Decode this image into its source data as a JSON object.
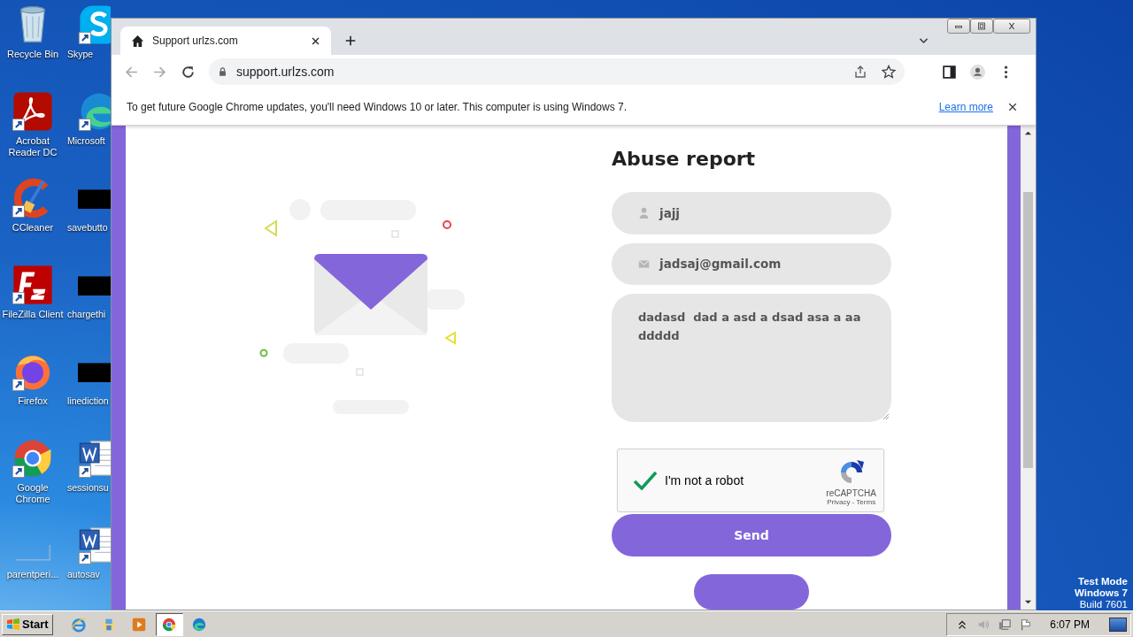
{
  "desktop": {
    "icons": [
      {
        "kind": "recycle",
        "label": "Recycle Bin",
        "shortcut": false
      },
      {
        "kind": "acrobat",
        "label": "Acrobat Reader DC",
        "shortcut": true
      },
      {
        "kind": "ccleaner",
        "label": "CCleaner",
        "shortcut": true
      },
      {
        "kind": "filezilla",
        "label": "FileZilla Client",
        "shortcut": true
      },
      {
        "kind": "firefox",
        "label": "Firefox",
        "shortcut": true
      },
      {
        "kind": "chrome",
        "label": "Google Chrome",
        "shortcut": true
      },
      {
        "kind": "blank",
        "label": "parentperi...",
        "shortcut": false
      },
      {
        "kind": "skype",
        "label": "Skype",
        "shortcut": true
      },
      {
        "kind": "edge",
        "label": "Microsoft",
        "shortcut": true
      },
      {
        "kind": "black",
        "label": "savebutto",
        "shortcut": false
      },
      {
        "kind": "black",
        "label": "chargethi",
        "shortcut": false
      },
      {
        "kind": "black",
        "label": "linediction",
        "shortcut": false
      },
      {
        "kind": "word",
        "label": "sessionsu",
        "shortcut": true
      },
      {
        "kind": "word",
        "label": "autosav",
        "shortcut": true
      }
    ],
    "test_mode": [
      {
        "text": "Test Mode",
        "bold": true
      },
      {
        "text": "Windows 7",
        "bold": true
      },
      {
        "text": "Build 7601",
        "bold": false
      }
    ]
  },
  "browser": {
    "tab": {
      "title": "Support urlzs.com"
    },
    "address": "support.urlzs.com",
    "infobar": {
      "message": "To get future Google Chrome updates, you'll need Windows 10 or later. This computer is using Windows 7.",
      "link": "Learn more"
    }
  },
  "page": {
    "heading": "Abuse report",
    "fields": [
      {
        "kind": "name",
        "value": "jajj"
      },
      {
        "kind": "email",
        "value": "jadsaj@gmail.com"
      },
      {
        "kind": "message",
        "value": "dadasd  dad a asd a dsad asa a aa   ddddd"
      }
    ],
    "captcha": {
      "checked": true,
      "label": "I'm not a robot",
      "brand": "reCAPTCHA",
      "links": "Privacy - Terms"
    },
    "send": "Send"
  },
  "taskbar": {
    "start": "Start",
    "apps": [
      {
        "kind": "ie",
        "selected": false
      },
      {
        "kind": "explorer",
        "selected": false
      },
      {
        "kind": "media",
        "selected": false
      },
      {
        "kind": "chrome",
        "selected": true
      },
      {
        "kind": "edge",
        "selected": false
      }
    ],
    "clock": "6:07 PM"
  }
}
